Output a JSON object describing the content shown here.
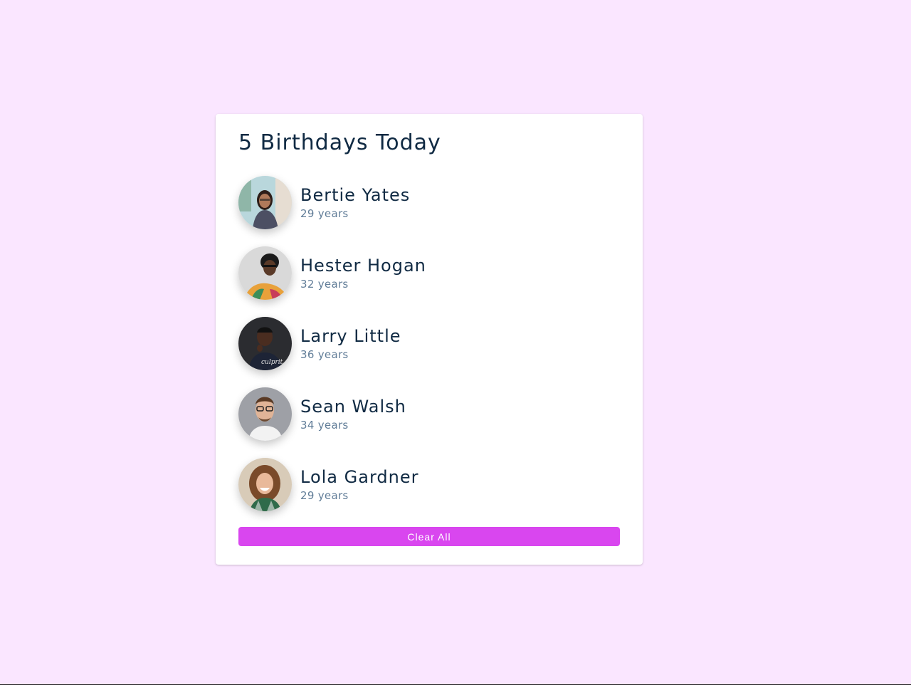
{
  "app": {
    "title": "5 Birthdays Today",
    "clear_label": "Clear All"
  },
  "people": [
    {
      "name": "Bertie Yates",
      "age": "29 years"
    },
    {
      "name": "Hester Hogan",
      "age": "32 years"
    },
    {
      "name": "Larry Little",
      "age": "36 years"
    },
    {
      "name": "Sean Walsh",
      "age": "34 years"
    },
    {
      "name": "Lola Gardner",
      "age": "29 years"
    }
  ],
  "colors": {
    "background": "#fae6ff",
    "accent": "#d946ef",
    "card": "#ffffff",
    "text": "#102a43",
    "muted": "#617d98"
  }
}
